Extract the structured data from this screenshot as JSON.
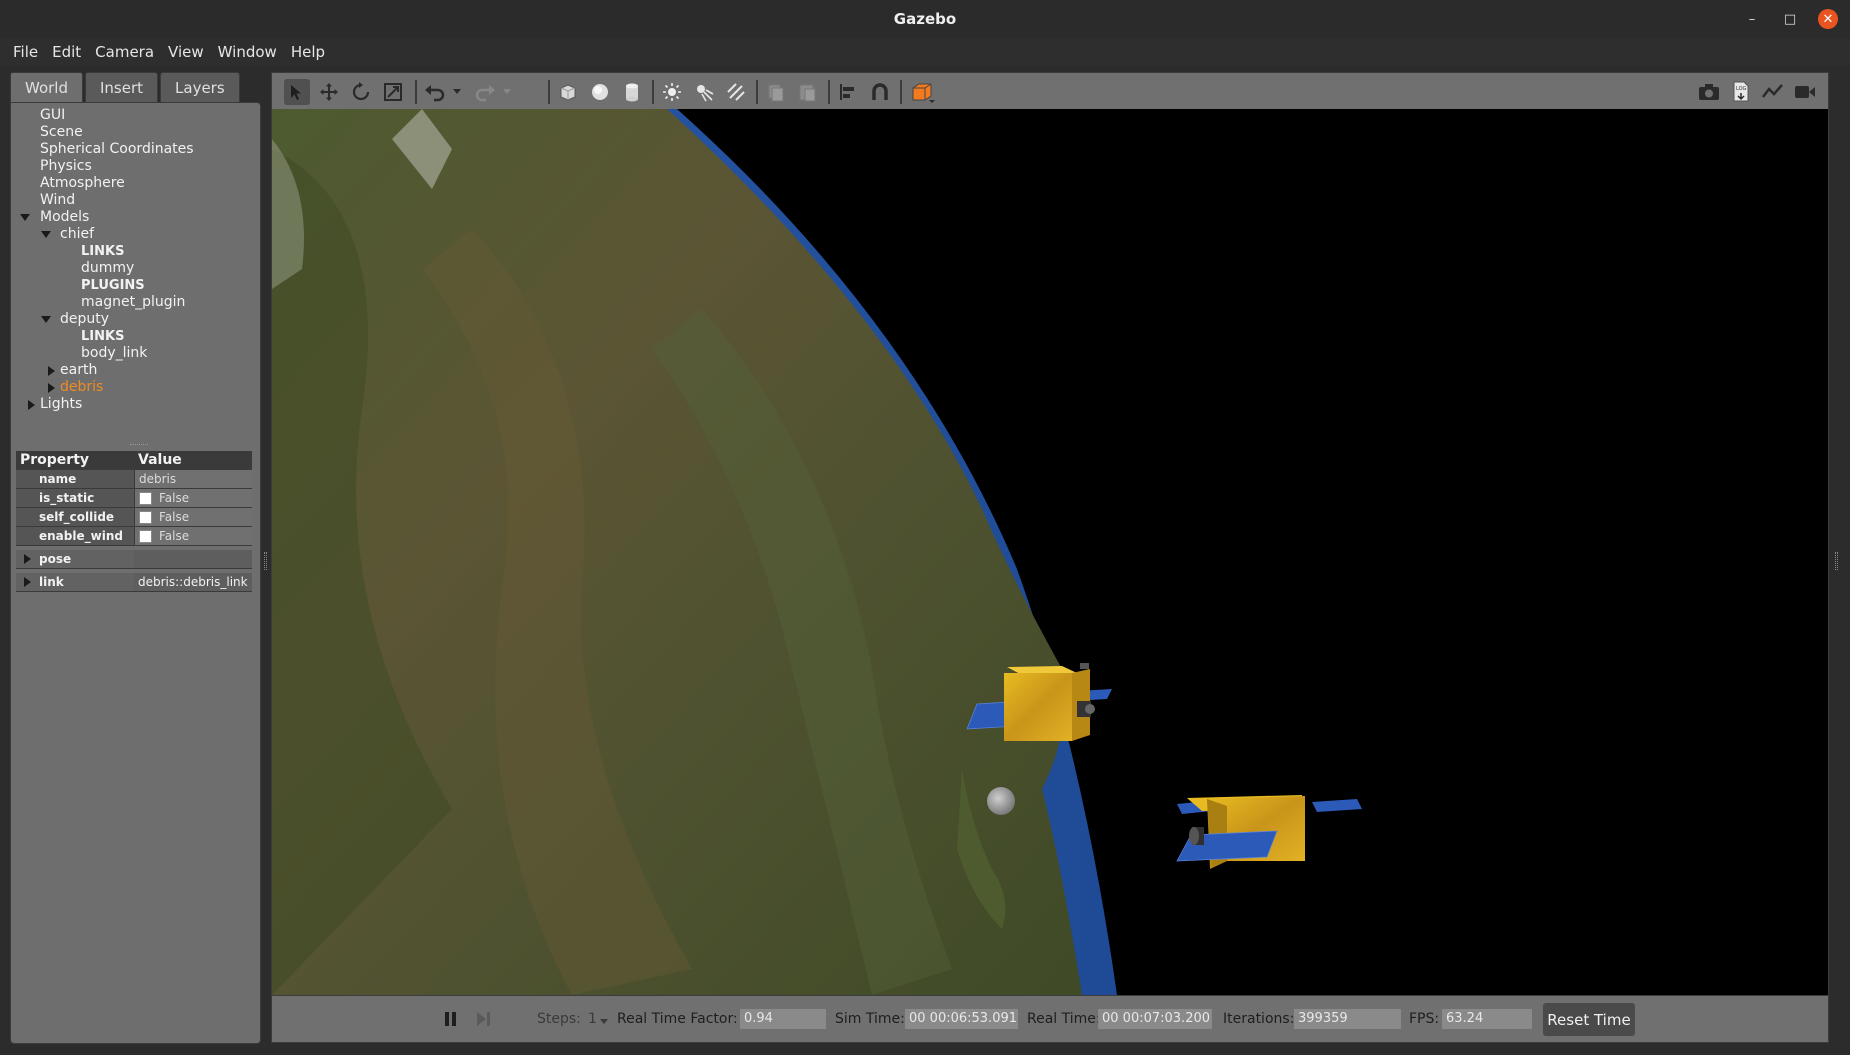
{
  "window": {
    "title": "Gazebo"
  },
  "menu": [
    "File",
    "Edit",
    "Camera",
    "View",
    "Window",
    "Help"
  ],
  "tabs": [
    "World",
    "Insert",
    "Layers"
  ],
  "tree": {
    "gui": "GUI",
    "scene": "Scene",
    "spherical": "Spherical Coordinates",
    "physics": "Physics",
    "atmosphere": "Atmosphere",
    "wind": "Wind",
    "models": "Models",
    "chief": "chief",
    "chief_links": "LINKS",
    "chief_dummy": "dummy",
    "chief_plugins": "PLUGINS",
    "chief_magnet": "magnet_plugin",
    "deputy": "deputy",
    "deputy_links": "LINKS",
    "deputy_body": "body_link",
    "earth": "earth",
    "debris": "debris",
    "lights": "Lights"
  },
  "properties": {
    "header": {
      "property": "Property",
      "value": "Value"
    },
    "name": {
      "label": "name",
      "value": "debris"
    },
    "is_static": {
      "label": "is_static",
      "value": "False"
    },
    "self_collide": {
      "label": "self_collide",
      "value": "False"
    },
    "enable_wind": {
      "label": "enable_wind",
      "value": "False"
    },
    "pose": {
      "label": "pose"
    },
    "link": {
      "label": "link",
      "value": "debris::debris_link"
    }
  },
  "toolbar_icons": [
    "select-arrow-icon",
    "translate-icon",
    "rotate-icon",
    "scale-icon",
    "undo-icon",
    "undo-dropdown-icon",
    "redo-icon",
    "redo-dropdown-icon",
    "box-icon",
    "sphere-icon",
    "cylinder-icon",
    "point-light-icon",
    "spot-light-icon",
    "directional-light-icon",
    "copy-icon",
    "paste-icon",
    "align-icon",
    "snap-icon",
    "view-angle-icon",
    "screenshot-icon",
    "log-icon",
    "plot-icon",
    "record-icon"
  ],
  "statusbar": {
    "steps_label": "Steps:",
    "steps_value": "1",
    "rtf_label": "Real Time Factor:",
    "rtf_value": "0.94",
    "sim_label": "Sim Time:",
    "sim_value": "00 00:06:53.091",
    "real_label": "Real Time:",
    "real_value": "00 00:07:03.200",
    "iter_label": "Iterations:",
    "iter_value": "399359",
    "fps_label": "FPS:",
    "fps_value": "63.24",
    "reset_label": "Reset Time"
  },
  "colors": {
    "selected": "#f08a24",
    "close": "#e95420",
    "panel": "#6e6e6e",
    "space": "#000000",
    "ocean": "#2b5fa8",
    "satellite": "#d9a816",
    "solar_panel": "#2c5ab8"
  }
}
